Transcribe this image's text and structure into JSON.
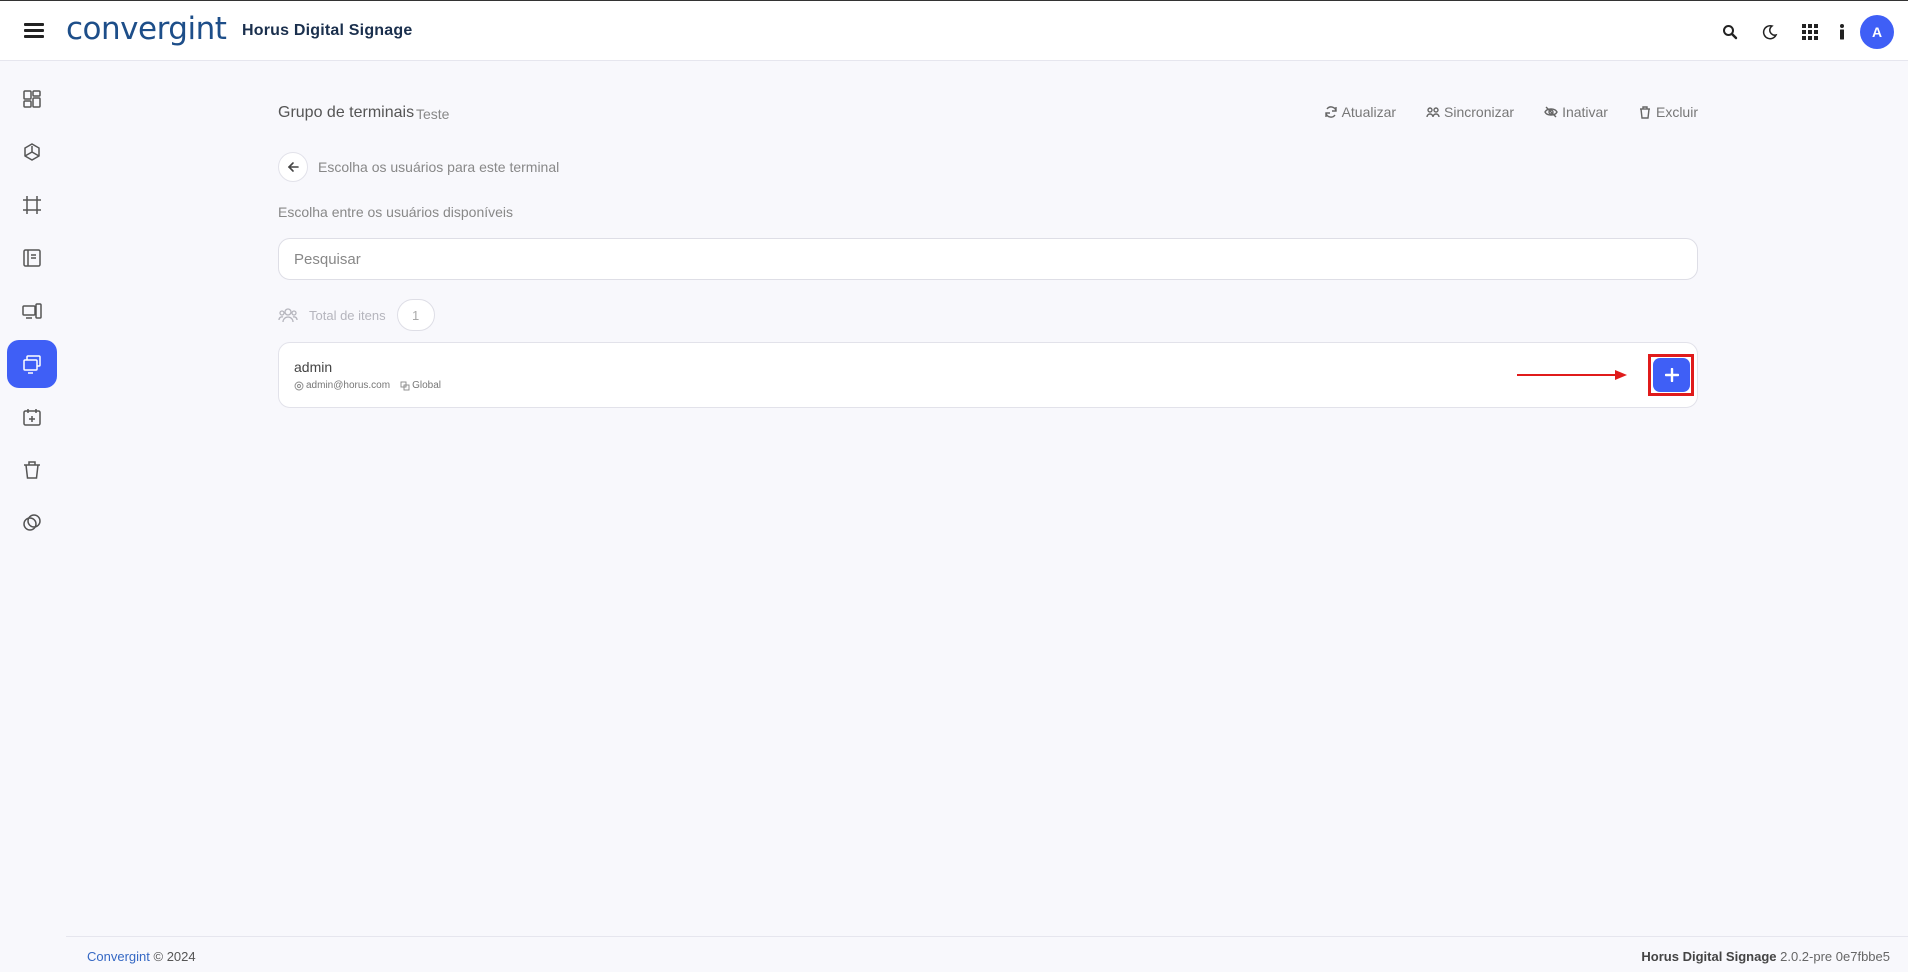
{
  "header": {
    "logo_text": "convergint",
    "logo_dot": "·",
    "app_title": "Horus Digital Signage",
    "icons": [
      "search-icon",
      "moon-icon",
      "apps-grid-icon",
      "info-icon"
    ],
    "avatar_initial": "A"
  },
  "sidebar": {
    "items": [
      {
        "name": "dashboard-icon",
        "active": false
      },
      {
        "name": "cube-icon",
        "active": false
      },
      {
        "name": "crop-frame-icon",
        "active": false
      },
      {
        "name": "layout-panel-icon",
        "active": false
      },
      {
        "name": "devices-icon",
        "active": false
      },
      {
        "name": "terminals-icon",
        "active": true
      },
      {
        "name": "calendar-add-icon",
        "active": false
      },
      {
        "name": "trash-icon",
        "active": false
      },
      {
        "name": "link-copy-icon",
        "active": false
      }
    ]
  },
  "page": {
    "group_label": "Grupo de terminais",
    "group_name": "Teste",
    "actions": {
      "refresh": "Atualizar",
      "sync": "Sincronizar",
      "deactivate": "Inativar",
      "delete": "Excluir"
    },
    "back_text": "Escolha os usuários para este terminal",
    "choose_label": "Escolha entre os usuários disponíveis",
    "search_placeholder": "Pesquisar",
    "total_label": "Total de itens",
    "total_count": "1"
  },
  "users": [
    {
      "name": "admin",
      "email": "admin@horus.com",
      "scope": "Global"
    }
  ],
  "footer": {
    "brand": "Convergint",
    "copyright": "© 2024",
    "product": "Horus Digital Signage",
    "version": "2.0.2-pre 0e7fbbe5"
  },
  "colors": {
    "accent": "#3f5ff6",
    "annotation": "#e01b1b",
    "brand_blue": "#1d4e89"
  }
}
